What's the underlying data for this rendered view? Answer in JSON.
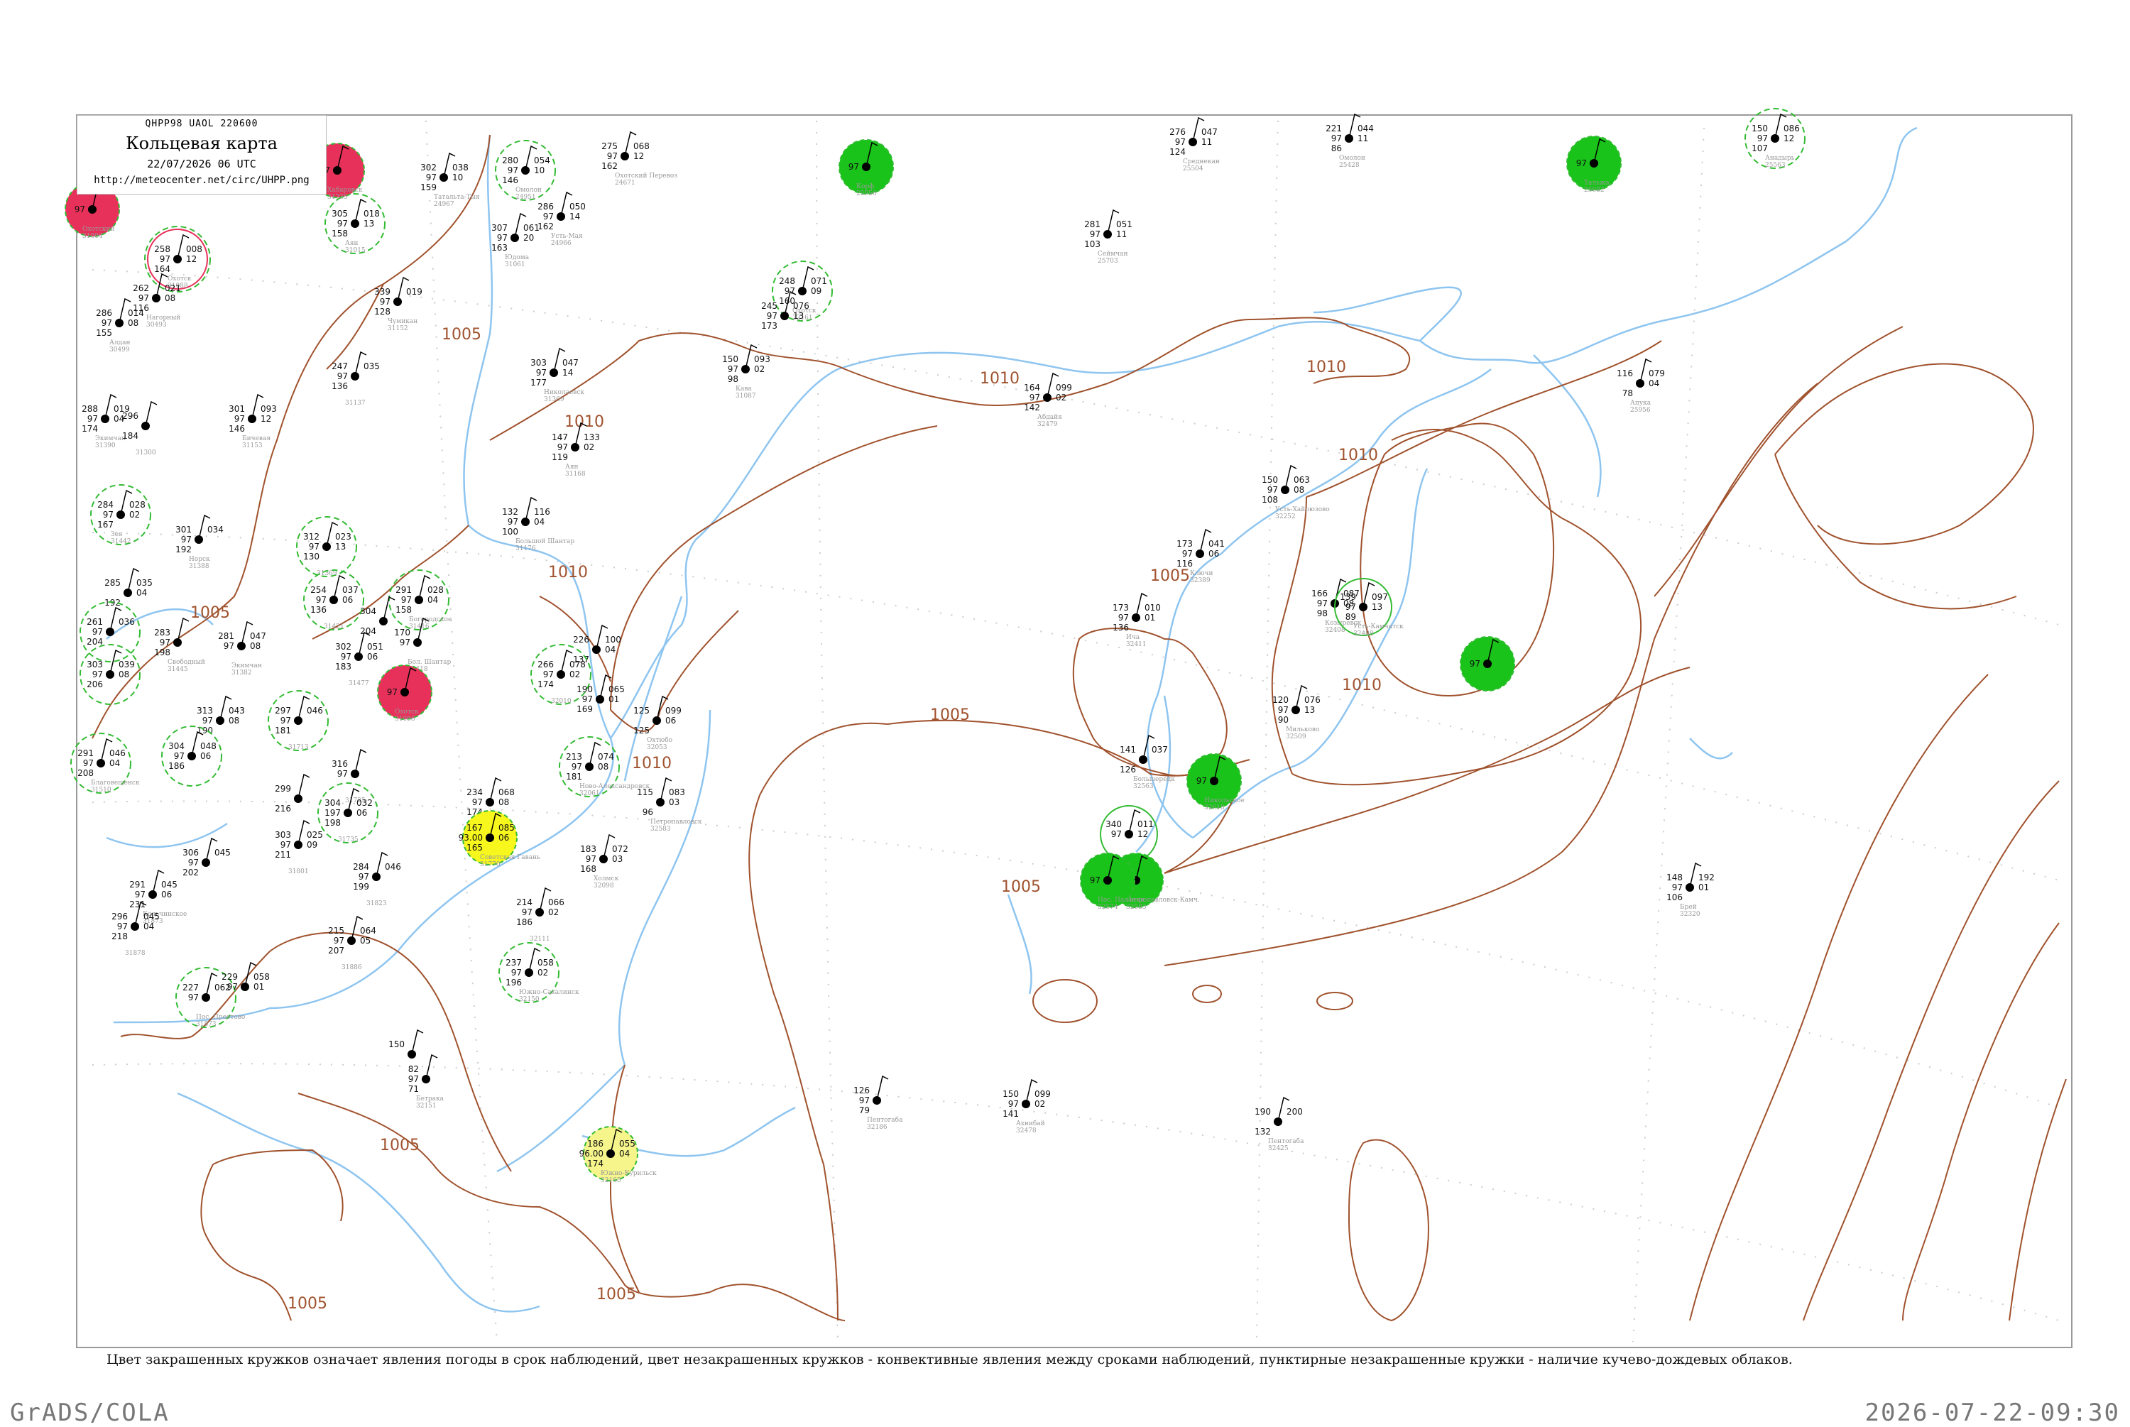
{
  "header": {
    "code": "QHPP98 UAOL 220600",
    "title": "Кольцевая карта",
    "date": "22/07/2026 06 UTC",
    "url": "http://meteocenter.net/circ/UHPP.png"
  },
  "caption": "Цвет закрашенных кружков означает явления погоды в срок наблюдений, цвет незакрашенных кружков - конвективные явления между сроками наблюдений, пунктирные незакрашенные кружки - наличие кучево-дождевых облаков.",
  "footer": {
    "left": "GrADS/COLA",
    "right": "2026-07-22-09:30"
  },
  "colors": {
    "frame": "#999999",
    "coast": "#8ec5f0",
    "isobar": "#a0522d",
    "green_fill": "#19c319",
    "red_fill": "#e8315a",
    "yellow_fill": "#f7f71e",
    "pale_yellow_fill": "#f5f58c",
    "cb_ring": "#33bb33",
    "text": "#111111",
    "name": "#999999"
  },
  "isobar_labels": [
    "1005",
    "1005",
    "1005",
    "1005",
    "1005",
    "1005",
    "1005",
    "1005",
    "1010",
    "1010",
    "1010",
    "1010",
    "1010",
    "1010",
    "1010",
    "1010"
  ],
  "stations": [
    {
      "top": "275",
      "right": "068",
      "mid": "97",
      "mr": "12",
      "bot": "162",
      "name": "Охотский Перевоз",
      "id": "24671",
      "marker": "none"
    },
    {
      "top": "302",
      "right": "038",
      "mid": "97",
      "mr": "10",
      "bot": "159",
      "name": "Татальта-Тыя",
      "id": "24967",
      "marker": "none"
    },
    {
      "top": "280",
      "right": "054",
      "mid": "97",
      "mr": "10",
      "bot": "146",
      "name": "Омолон",
      "id": "24951",
      "marker": "cb"
    },
    {
      "top": "286",
      "right": "050",
      "mid": "97",
      "mr": "14",
      "bot": "162",
      "name": "Усть-Мая",
      "id": "24966",
      "marker": "none"
    },
    {
      "top": "307",
      "right": "061",
      "mid": "97",
      "mr": "20",
      "bot": "163",
      "name": "Юдома",
      "id": "31061",
      "marker": "none"
    },
    {
      "top": "305",
      "right": "018",
      "mid": "97",
      "mr": "13",
      "bot": "158",
      "name": "Аян",
      "id": "31015",
      "marker": "cb"
    },
    {
      "top": "258",
      "right": "008",
      "mid": "97",
      "mr": "12",
      "bot": "164",
      "name": "Охотск",
      "id": "31088",
      "marker": "red_ring"
    },
    {
      "top": "262",
      "right": "021",
      "mid": "97",
      "mr": "08",
      "bot": "116",
      "name": "Нагорный",
      "id": "30493",
      "marker": "none"
    },
    {
      "top": "286",
      "right": "014",
      "mid": "97",
      "mr": "08",
      "bot": "155",
      "name": "Алдан",
      "id": "30499",
      "marker": "none"
    },
    {
      "top": "339",
      "right": "019",
      "mid": "97",
      "mr": "",
      "bot": "128",
      "name": "Чумикан",
      "id": "31152",
      "marker": "none"
    },
    {
      "top": "247",
      "right": "035",
      "mid": "97",
      "mr": "",
      "bot": "136",
      "name": "",
      "id": "31137",
      "marker": "none"
    },
    {
      "top": "303",
      "right": "047",
      "mid": "97",
      "mr": "14",
      "bot": "177",
      "name": "Николаевск",
      "id": "31369",
      "marker": "none"
    },
    {
      "top": "288",
      "right": "019",
      "mid": "97",
      "mr": "04",
      "bot": "174",
      "name": "Экимчан",
      "id": "31390",
      "marker": "none"
    },
    {
      "top": "296",
      "right": "",
      "mid": "",
      "mr": "",
      "bot": "184",
      "name": "",
      "id": "31300",
      "marker": "none"
    },
    {
      "top": "301",
      "right": "093",
      "mid": "97",
      "mr": "12",
      "bot": "146",
      "name": "Бичевая",
      "id": "31153",
      "marker": "none"
    },
    {
      "top": "284",
      "right": "028",
      "mid": "97",
      "mr": "02",
      "bot": "167",
      "name": "Зея",
      "id": "31442",
      "marker": "cb"
    },
    {
      "top": "301",
      "right": "034",
      "mid": "97",
      "mr": "",
      "bot": "192",
      "name": "Норск",
      "id": "31388",
      "marker": "none"
    },
    {
      "top": "312",
      "right": "023",
      "mid": "97",
      "mr": "13",
      "bot": "130",
      "name": "",
      "id": "31369",
      "marker": "cb"
    },
    {
      "top": "254",
      "right": "037",
      "mid": "97",
      "mr": "06",
      "bot": "136",
      "name": "",
      "id": "31421",
      "marker": "cb"
    },
    {
      "top": "291",
      "right": "028",
      "mid": "97",
      "mr": "04",
      "bot": "158",
      "name": "Богородское",
      "id": "31416",
      "marker": "cb"
    },
    {
      "top": "304",
      "right": "",
      "mid": "",
      "mr": "",
      "bot": "204",
      "name": "",
      "id": "",
      "marker": "none"
    },
    {
      "top": "285",
      "right": "035",
      "mid": "",
      "mr": "04",
      "bot": "192",
      "name": "",
      "id": "",
      "marker": "none"
    },
    {
      "top": "261",
      "right": "036",
      "mid": "97",
      "mr": "",
      "bot": "204",
      "name": "",
      "id": "",
      "marker": "cb"
    },
    {
      "top": "283",
      "right": "",
      "mid": "97",
      "mr": "",
      "bot": "198",
      "name": "Свободный",
      "id": "31445",
      "marker": "none"
    },
    {
      "top": "281",
      "right": "047",
      "mid": "97",
      "mr": "08",
      "bot": "",
      "name": "Экимчан",
      "id": "31382",
      "marker": "none"
    },
    {
      "top": "303",
      "right": "039",
      "mid": "97",
      "mr": "08",
      "bot": "206",
      "name": "",
      "id": "",
      "marker": "cb"
    },
    {
      "top": "302",
      "right": "051",
      "mid": "97",
      "mr": "06",
      "bot": "183",
      "name": "",
      "id": "31477",
      "marker": "none"
    },
    {
      "top": "170",
      "right": "",
      "mid": "97",
      "mr": "",
      "bot": "",
      "name": "Бол. Шантар",
      "id": "31418",
      "marker": "none"
    },
    {
      "top": "297",
      "right": "046",
      "mid": "97",
      "mr": "",
      "bot": "181",
      "name": "",
      "id": "31713",
      "marker": "cb"
    },
    {
      "top": "313",
      "right": "043",
      "mid": "97",
      "mr": "08",
      "bot": "190",
      "name": "",
      "id": "",
      "marker": "none"
    },
    {
      "top": "304",
      "right": "048",
      "mid": "97",
      "mr": "06",
      "bot": "186",
      "name": "",
      "id": "",
      "marker": "cb"
    },
    {
      "top": "291",
      "right": "046",
      "mid": "97",
      "mr": "04",
      "bot": "208",
      "name": "Благовещенск",
      "id": "31510",
      "marker": "cb"
    },
    {
      "top": "316",
      "right": "",
      "mid": "97",
      "mr": "",
      "bot": "",
      "name": "",
      "id": "31725",
      "marker": "none"
    },
    {
      "top": "299",
      "right": "",
      "mid": "",
      "mr": "",
      "bot": "216",
      "name": "",
      "id": "",
      "marker": "none"
    },
    {
      "top": "304",
      "right": "032",
      "mid": "197",
      "mr": "06",
      "bot": "198",
      "name": "",
      "id": "31735",
      "marker": "cb"
    },
    {
      "top": "303",
      "right": "025",
      "mid": "97",
      "mr": "09",
      "bot": "211",
      "name": "",
      "id": "31801",
      "marker": "none"
    },
    {
      "top": "306",
      "right": "045",
      "mid": "97",
      "mr": "",
      "bot": "202",
      "name": "",
      "id": "",
      "marker": "none"
    },
    {
      "top": "291",
      "right": "045",
      "mid": "97",
      "mr": "06",
      "bot": "231",
      "name": "Кольчинское",
      "id": "31873",
      "marker": "none"
    },
    {
      "top": "284",
      "right": "046",
      "mid": "97",
      "mr": "",
      "bot": "199",
      "name": "",
      "id": "31823",
      "marker": "none"
    },
    {
      "top": "215",
      "right": "064",
      "mid": "97",
      "mr": "05",
      "bot": "207",
      "name": "",
      "id": "31886",
      "marker": "none"
    },
    {
      "top": "296",
      "right": "045",
      "mid": "97",
      "mr": "04",
      "bot": "218",
      "name": "",
      "id": "31878",
      "marker": "none"
    },
    {
      "top": "227",
      "right": "062",
      "mid": "97",
      "mr": "",
      "bot": "",
      "name": "Пос. Преотово",
      "id": "31873",
      "marker": "cb"
    },
    {
      "top": "229",
      "right": "058",
      "mid": "97",
      "mr": "01",
      "bot": "",
      "name": "",
      "id": "",
      "marker": "none"
    },
    {
      "top": "234",
      "right": "068",
      "mid": "97",
      "mr": "08",
      "bot": "174",
      "name": "",
      "id": "",
      "marker": "none"
    },
    {
      "top": "167",
      "right": "085",
      "mid": "93.00",
      "mr": "06",
      "bot": "165",
      "name": "Советская Гавань",
      "id": "31770",
      "marker": "yellow"
    },
    {
      "top": "226",
      "right": "100",
      "mid": "",
      "mr": "04",
      "bot": "137",
      "name": "",
      "id": "",
      "marker": "none"
    },
    {
      "top": "266",
      "right": "078",
      "mid": "97",
      "mr": "02",
      "bot": "174",
      "name": "",
      "id": "32010",
      "marker": "cb"
    },
    {
      "top": "190",
      "right": "065",
      "mid": "97",
      "mr": "01",
      "bot": "169",
      "name": "",
      "id": "",
      "marker": "none"
    },
    {
      "top": "125",
      "right": "099",
      "mid": "",
      "mr": "06",
      "bot": "125",
      "name": "Охтюбо",
      "id": "32053",
      "marker": "none"
    },
    {
      "top": "213",
      "right": "074",
      "mid": "97",
      "mr": "08",
      "bot": "181",
      "name": "Ново-Александровск",
      "id": "32061",
      "marker": "cb"
    },
    {
      "top": "115",
      "right": "083",
      "mid": "",
      "mr": "03",
      "bot": "96",
      "name": "Петропавловск",
      "id": "32583",
      "marker": "none"
    },
    {
      "top": "183",
      "right": "072",
      "mid": "97",
      "mr": "03",
      "bot": "168",
      "name": "Холмск",
      "id": "32098",
      "marker": "none"
    },
    {
      "top": "214",
      "right": "066",
      "mid": "97",
      "mr": "02",
      "bot": "186",
      "name": "",
      "id": "32111",
      "marker": "none"
    },
    {
      "top": "237",
      "right": "058",
      "mid": "97",
      "mr": "02",
      "bot": "196",
      "name": "Южно-Сахалинск",
      "id": "32150",
      "marker": "cb"
    },
    {
      "top": "150",
      "right": "",
      "mid": "",
      "mr": "",
      "bot": "",
      "name": "",
      "id": "",
      "marker": "none"
    },
    {
      "top": "82",
      "right": "",
      "mid": "97",
      "mr": "",
      "bot": "71",
      "name": "Бетрака",
      "id": "32151",
      "marker": "none"
    },
    {
      "top": "186",
      "right": "055",
      "mid": "96.00",
      "mr": "04",
      "bot": "174",
      "name": "Южно-Курильск",
      "id": "32165",
      "marker": "pale_yellow"
    },
    {
      "top": "126",
      "right": "",
      "mid": "97",
      "mr": "",
      "bot": "79",
      "name": "Пентогаба",
      "id": "32186",
      "marker": "none"
    },
    {
      "top": "190",
      "right": "200",
      "mid": "",
      "mr": "",
      "bot": "132",
      "name": "Пентогаба",
      "id": "32425",
      "marker": "none"
    },
    {
      "top": "150",
      "right": "099",
      "mid": "97",
      "mr": "02",
      "bot": "141",
      "name": "Ахнибай",
      "id": "32478",
      "marker": "none"
    },
    {
      "top": "164",
      "right": "099",
      "mid": "97",
      "mr": "02",
      "bot": "142",
      "name": "Абдайя",
      "id": "32479",
      "marker": "none"
    },
    {
      "top": "248",
      "right": "071",
      "mid": "97",
      "mr": "09",
      "bot": "160",
      "name": "Охотск",
      "id": "32161",
      "marker": "cb"
    },
    {
      "top": "245",
      "right": "076",
      "mid": "97",
      "mr": "13",
      "bot": "173",
      "name": "",
      "id": "",
      "marker": "none"
    },
    {
      "top": "150",
      "right": "093",
      "mid": "97",
      "mr": "02",
      "bot": "98",
      "name": "Кава",
      "id": "31087",
      "marker": "none"
    },
    {
      "top": "147",
      "right": "133",
      "mid": "97",
      "mr": "02",
      "bot": "119",
      "name": "Аян",
      "id": "31168",
      "marker": "none"
    },
    {
      "top": "132",
      "right": "116",
      "mid": "97",
      "mr": "04",
      "bot": "100",
      "name": "Большой Шантар",
      "id": "31176",
      "marker": "none"
    },
    {
      "top": "281",
      "right": "051",
      "mid": "97",
      "mr": "11",
      "bot": "103",
      "name": "Сеймчан",
      "id": "25703",
      "marker": "none"
    },
    {
      "top": "276",
      "right": "047",
      "mid": "97",
      "mr": "11",
      "bot": "124",
      "name": "Среднекан",
      "id": "25504",
      "marker": "none"
    },
    {
      "top": "221",
      "right": "044",
      "mid": "97",
      "mr": "11",
      "bot": "86",
      "name": "Омолон",
      "id": "25428",
      "marker": "none"
    },
    {
      "top": "150",
      "right": "086",
      "mid": "97",
      "mr": "12",
      "bot": "107",
      "name": "Анадырь",
      "id": "25563",
      "marker": "cb"
    },
    {
      "top": "116",
      "right": "079",
      "mid": "",
      "mr": "04",
      "bot": "78",
      "name": "Апука",
      "id": "25956",
      "marker": "none"
    },
    {
      "top": "150",
      "right": "063",
      "mid": "97",
      "mr": "08",
      "bot": "108",
      "name": "Усть-Хайрюзово",
      "id": "32252",
      "marker": "none"
    },
    {
      "top": "173",
      "right": "041",
      "mid": "97",
      "mr": "06",
      "bot": "116",
      "name": "Ключи",
      "id": "32389",
      "marker": "none"
    },
    {
      "top": "173",
      "right": "010",
      "mid": "97",
      "mr": "01",
      "bot": "136",
      "name": "Ича",
      "id": "32411",
      "marker": "none"
    },
    {
      "top": "166",
      "right": "087",
      "mid": "97",
      "mr": "08",
      "bot": "98",
      "name": "Козыревск",
      "id": "32408",
      "marker": "none"
    },
    {
      "top": "139",
      "right": "097",
      "mid": "97",
      "mr": "13",
      "bot": "89",
      "name": "Усть-Камчатск",
      "id": "32408",
      "marker": "green_ring"
    },
    {
      "top": "120",
      "right": "076",
      "mid": "97",
      "mr": "13",
      "bot": "90",
      "name": "Мильково",
      "id": "32509",
      "marker": "none"
    },
    {
      "top": "141",
      "right": "037",
      "mid": "",
      "mr": "",
      "bot": "126",
      "name": "Большерецк",
      "id": "32563",
      "marker": "none"
    },
    {
      "top": "340",
      "right": "011",
      "mid": "97",
      "mr": "12",
      "bot": "",
      "name": "",
      "id": "",
      "marker": "green_ring"
    },
    {
      "top": "148",
      "right": "192",
      "mid": "97",
      "mr": "01",
      "bot": "106",
      "name": "Брей",
      "id": "32320",
      "marker": "none"
    },
    {
      "top": "",
      "right": "",
      "mid": "97",
      "mr": "",
      "bot": "",
      "name": "Петропавловск-Камч.",
      "id": "32583",
      "marker": "green"
    },
    {
      "top": "",
      "right": "",
      "mid": "97",
      "mr": "",
      "bot": "",
      "name": "Никольское",
      "id": "32618",
      "marker": "green"
    },
    {
      "top": "",
      "right": "",
      "mid": "97",
      "mr": "",
      "bot": "",
      "name": "Пос. Паланки",
      "id": "32574",
      "marker": "green"
    },
    {
      "top": "",
      "right": "",
      "mid": "97",
      "mr": "",
      "bot": "",
      "name": "Корф",
      "id": "25956",
      "marker": "green"
    },
    {
      "top": "",
      "right": "",
      "mid": "97",
      "mr": "",
      "bot": "",
      "name": "Тальжа",
      "id": "25682",
      "marker": "green"
    },
    {
      "top": "",
      "right": "",
      "mid": "97",
      "mr": "",
      "bot": "",
      "name": "",
      "id": "",
      "marker": "green"
    },
    {
      "top": "",
      "right": "",
      "mid": "97",
      "mr": "",
      "bot": "",
      "name": "Охотский",
      "id": "31004",
      "marker": "red"
    },
    {
      "top": "",
      "right": "",
      "mid": "97",
      "mr": "",
      "bot": "",
      "name": "Хабаровск",
      "id": "31735",
      "marker": "red"
    },
    {
      "top": "",
      "right": "",
      "mid": "97",
      "mr": "",
      "bot": "",
      "name": "Охотск",
      "id": "31088",
      "marker": "red"
    }
  ]
}
